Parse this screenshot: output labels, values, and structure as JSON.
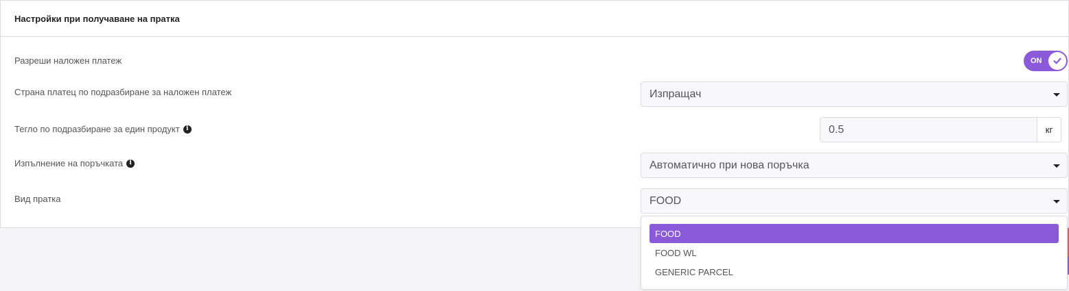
{
  "panel": {
    "title": "Настройки при получаване на пратка"
  },
  "settings": {
    "allow_cod": {
      "label": "Разреши наложен платеж",
      "toggle_label": "ON",
      "enabled": true
    },
    "cod_payer": {
      "label": "Страна платец по подразбиране за наложен платеж",
      "value": "Изпращач"
    },
    "default_weight": {
      "label": "Тегло по подразбиране за един продукт",
      "value": "0.5",
      "unit": "кг"
    },
    "fulfillment": {
      "label": "Изпълнение на поръчката",
      "value": "Автоматично при нова поръчка"
    },
    "shipment_type": {
      "label": "Вид пратка",
      "value": "FOOD",
      "options": [
        "FOOD",
        "FOOD WL",
        "GENERIC PARCEL"
      ]
    }
  },
  "colors": {
    "accent": "#8a5ad8",
    "edge_red": "#e05a5a",
    "edge_purple": "#8a5ad8"
  },
  "icons": {
    "info": "info-circle-icon",
    "check": "check-icon",
    "caret": "caret-down-icon"
  }
}
